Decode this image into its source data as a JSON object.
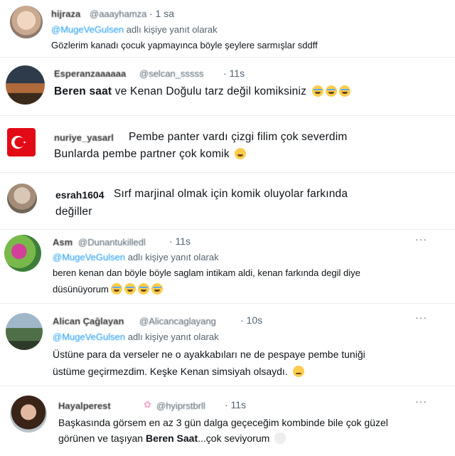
{
  "tweets": [
    {
      "name": "hijraza",
      "handle": "@aaayhamza",
      "time": "· 1 sa",
      "reply_mention": "@MugeVeGulsen",
      "reply_suffix": "adlı kişiye yanıt olarak",
      "lines": [
        "Gözlerim kanadı çocuk yapmayınca böyle şeylere sarmışlar sddff"
      ]
    },
    {
      "name": "Esperanzaaaaaa",
      "handle": "@selcan_sssss",
      "time": "· 11s",
      "bold_prefix": "Beren saat",
      "lines": [
        " ve Kenan Doğulu tarz değil komiksiniz"
      ],
      "emoji": "face-with-tears-of-joy x3"
    },
    {
      "name": "nuriye_yasarl",
      "lines": [
        "Pembe panter vardı çizgi filim çok severdim",
        "Bunlarda pembe partner çok komik"
      ],
      "emoji": "grinning-squinting-face"
    },
    {
      "name": "esrah1604",
      "lines": [
        "Sırf marjinal olmak için komik oluyolar farkında",
        "değiller"
      ]
    },
    {
      "name": "Asm",
      "handle": "@Dunantukilledl",
      "time": "· 11s",
      "reply_mention": "@MugeVeGulsen",
      "reply_suffix": "adlı kişiye yanıt olarak",
      "lines": [
        "beren kenan dan böyle böyle saglam intikam aldi, kenan farkında degil diye",
        "düsünüyorum"
      ],
      "emoji": "rolling-on-floor-laughing x4",
      "more_label": "···"
    },
    {
      "name": "Alican Çağlayan",
      "handle": "@Alicancaglayang",
      "time": "· 10s",
      "reply_mention": "@MugeVeGulsen",
      "reply_suffix": "adlı kişiye yanıt olarak",
      "lines": [
        "Üstüne para da verseler ne o ayakkabıları ne de pespaye pembe tuniği",
        "üstüme geçirmezdim. Keşke Kenan simsiyah olsaydı."
      ],
      "emoji": "worried-face",
      "more_label": "···"
    },
    {
      "name": "Hayalperest",
      "handle": "@hyiprstbrll",
      "time": "· 11s",
      "lines": [
        "Başkasında görsem en az 3 gün dalga geçeceğim kombinde bile çok güzel",
        "görünen ve taşıyan"
      ],
      "bold_suffix": "Beren Saat",
      "tail": "...çok seviyorum",
      "emoji": "white-heart",
      "more_label": "···"
    }
  ],
  "colors": {
    "link": "#1d9bf0",
    "muted": "#536471",
    "text": "#0f1419"
  }
}
